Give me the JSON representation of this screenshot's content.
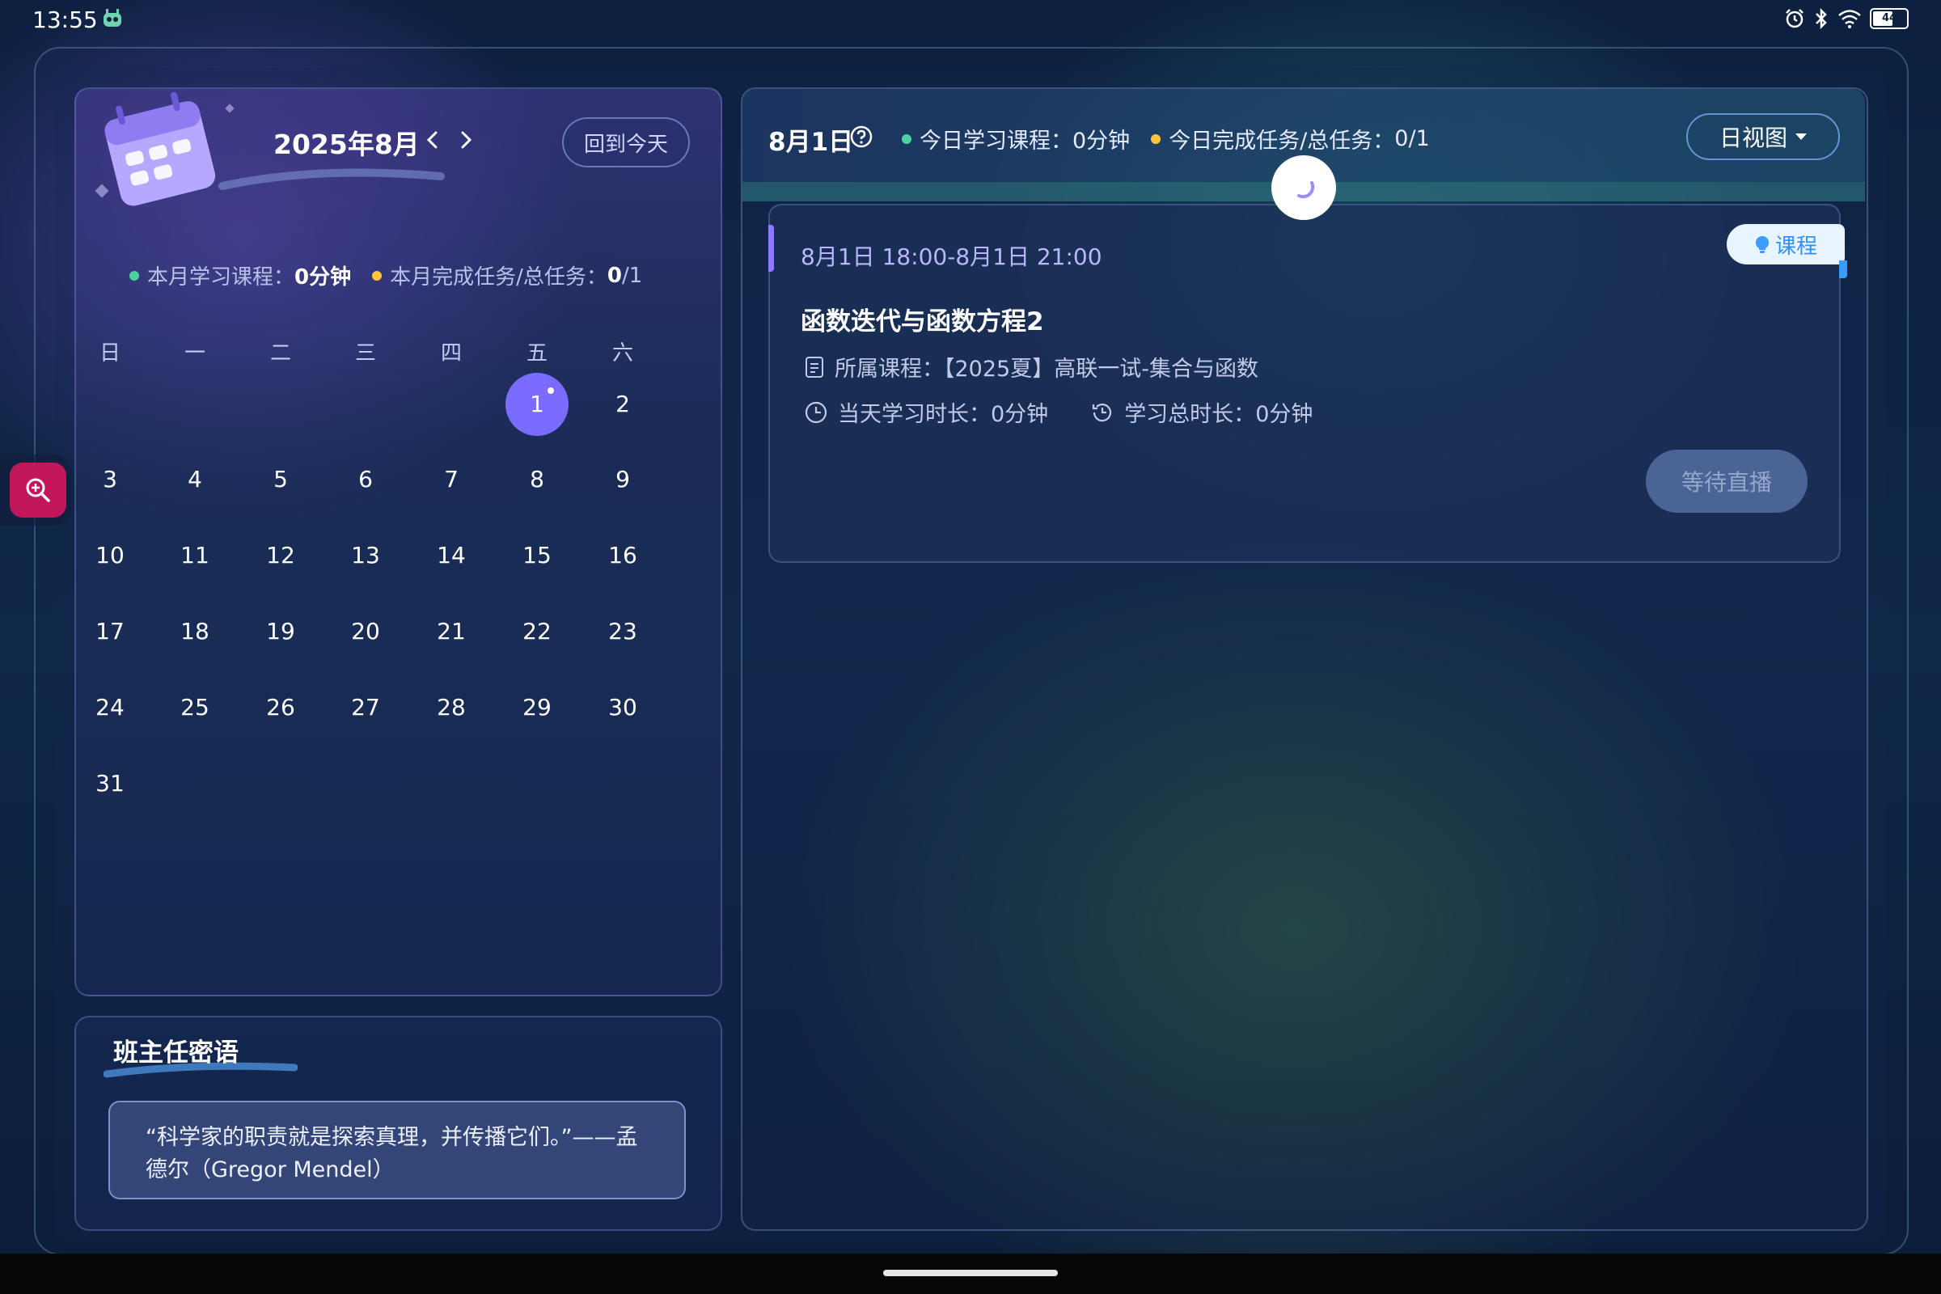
{
  "status_bar": {
    "time": "13:55",
    "battery": "44",
    "icons": [
      "app-robot-icon",
      "alarm-icon",
      "bluetooth-icon",
      "wifi-icon",
      "battery-icon"
    ]
  },
  "calendar": {
    "title": "2025年8月",
    "today_button": "回到今天",
    "stats": {
      "study_label": "本月学习课程：",
      "study_value": "0分钟",
      "task_label": "本月完成任务/总任务：",
      "task_value": "0",
      "task_total": "/1"
    },
    "weekdays": [
      "日",
      "一",
      "二",
      "三",
      "四",
      "五",
      "六"
    ],
    "days": [
      "1",
      "2",
      "3",
      "4",
      "5",
      "6",
      "7",
      "8",
      "9",
      "10",
      "11",
      "12",
      "13",
      "14",
      "15",
      "16",
      "17",
      "18",
      "19",
      "20",
      "21",
      "22",
      "23",
      "24",
      "25",
      "26",
      "27",
      "28",
      "29",
      "30",
      "31"
    ],
    "first_weekday_index": 5,
    "selected_day": "1",
    "accent_color": "#7b6cff"
  },
  "teacher_note": {
    "title": "班主任密语",
    "quote_line1": "“科学家的职责就是探索真理，并传播它们。”——孟",
    "quote_line2": "德尔（Gregor Mendel）"
  },
  "day_view": {
    "date": "8月1日",
    "today_study_label": "今日学习课程：",
    "today_study_value": "0分钟",
    "today_task_label": "今日完成任务/总任务：",
    "today_task_value": "0/1",
    "view_select": "日视图",
    "event": {
      "time": "8月1日 18:00-8月1日 21:00",
      "badge": "课程",
      "title": "函数迭代与函数方程2",
      "course_label": "所属课程：",
      "course_value": "【2025夏】高联一试-集合与函数",
      "today_duration_label": "当天学习时长：",
      "today_duration_value": "0分钟",
      "total_duration_label": "学习总时长：",
      "total_duration_value": "0分钟",
      "action_button": "等待直播"
    }
  }
}
